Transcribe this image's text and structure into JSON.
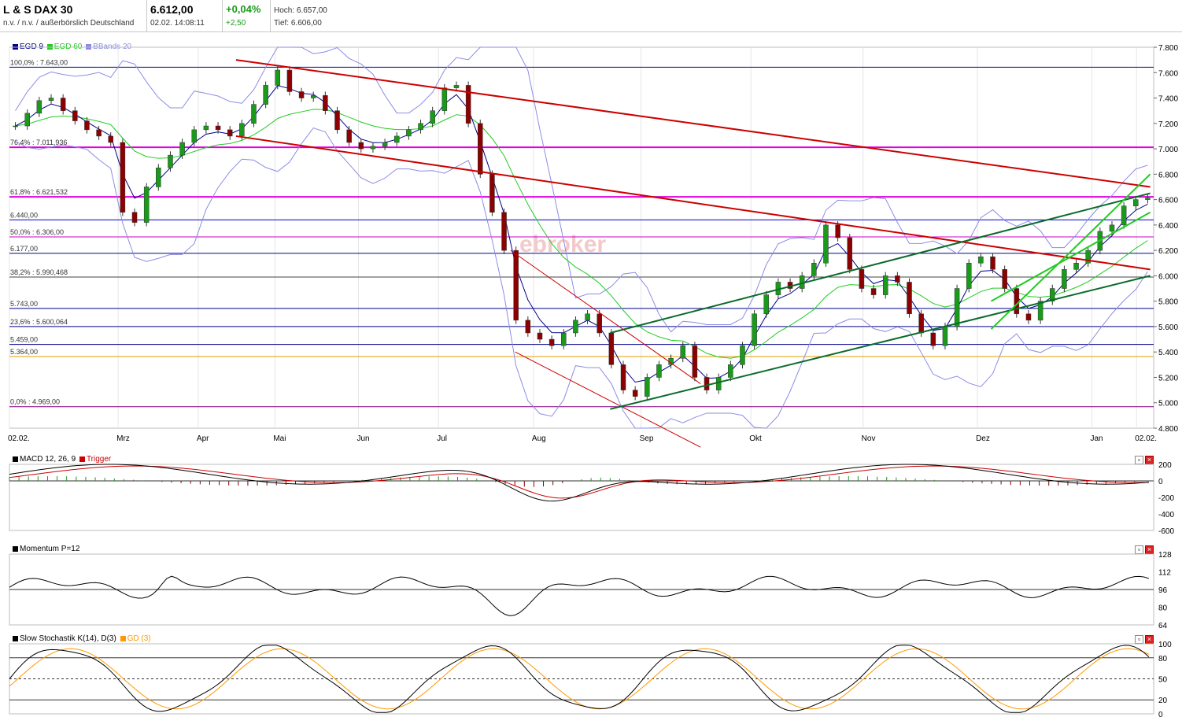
{
  "header": {
    "name": "L & S DAX 30",
    "exchange": "n.v. / n.v. / außerbörslich Deutschland",
    "price": "6.612,00",
    "datetime": "02.02. 14:08:11",
    "change_pct": "+0,04%",
    "change_abs": "+2,50",
    "high": "Hoch: 6.657,00",
    "low": "Tief: 6.606,00"
  },
  "main_panel": {
    "legend": [
      {
        "label": "EGD 9",
        "color": "#00008b"
      },
      {
        "label": "EGD 60",
        "color": "#22cc22"
      },
      {
        "label": "BBands 20",
        "color": "#8c8ce6"
      }
    ],
    "watermark": "ebroker",
    "colors": {
      "up": "#1a9a1a",
      "down": "#8b0000",
      "ema9": "#00008b",
      "ema60": "#22cc22",
      "bb": "#8c8ce6",
      "trend_red": "#cc0000",
      "trend_green": "#0a6b2a",
      "fib": "#000000"
    }
  },
  "chart_data": [
    {
      "type": "candlestick",
      "title": "L & S DAX 30",
      "y_ticks": [
        "7.800",
        "7.600",
        "7.400",
        "7.200",
        "7.000",
        "6.800",
        "6.600",
        "6.400",
        "6.200",
        "6.000",
        "5.800",
        "5.600",
        "5.400",
        "5.200",
        "5.000",
        "4.800"
      ],
      "ylim": [
        4800,
        7800
      ],
      "x_ticks": [
        "02.02.",
        "Mrz",
        "Apr",
        "Mai",
        "Jun",
        "Jul",
        "Aug",
        "Sep",
        "Okt",
        "Nov",
        "Dez",
        "Jan",
        "02.02."
      ],
      "levels": [
        {
          "label": "100,0% : 7.643,00",
          "value": 7643,
          "color": "#00008b"
        },
        {
          "label": "76,4% : 7.011,936",
          "value": 7011.936,
          "color": "#e000e0"
        },
        {
          "label": "61,8% : 6.621,532",
          "value": 6621.532,
          "color": "#e000e0"
        },
        {
          "label": "6.440,00",
          "value": 6440,
          "color": "#0000cc"
        },
        {
          "label": "50,0% : 6.306,00",
          "value": 6306,
          "color": "#cc00cc"
        },
        {
          "label": "6.177,00",
          "value": 6177,
          "color": "#00008b"
        },
        {
          "label": "38,2% : 5.990,468",
          "value": 5990.468,
          "color": "#444444"
        },
        {
          "label": "5.743,00",
          "value": 5743,
          "color": "#00008b"
        },
        {
          "label": "23,6% : 5.600,064",
          "value": 5600.064,
          "color": "#00008b"
        },
        {
          "label": "5.459,00",
          "value": 5459,
          "color": "#00008b"
        },
        {
          "label": "5.364,00",
          "value": 5364,
          "color": "#e0a000"
        },
        {
          "label": "0,0% : 4.969,00",
          "value": 4969,
          "color": "#800080"
        }
      ],
      "close_series": [
        7180,
        7280,
        7380,
        7400,
        7300,
        7220,
        7150,
        7100,
        7050,
        6500,
        6420,
        6700,
        6850,
        6950,
        7050,
        7150,
        7180,
        7150,
        7100,
        7200,
        7350,
        7500,
        7620,
        7450,
        7400,
        7420,
        7300,
        7150,
        7050,
        7000,
        7020,
        7050,
        7100,
        7150,
        7200,
        7300,
        7480,
        7500,
        7200,
        6800,
        6500,
        6200,
        5650,
        5550,
        5500,
        5450,
        5550,
        5650,
        5700,
        5550,
        5300,
        5100,
        5050,
        5200,
        5300,
        5350,
        5450,
        5200,
        5100,
        5200,
        5300,
        5450,
        5700,
        5850,
        5950,
        5900,
        6000,
        6100,
        6400,
        6300,
        6050,
        5900,
        5850,
        6000,
        5950,
        5700,
        5550,
        5450,
        5600,
        5900,
        6100,
        6150,
        6050,
        5900,
        5700,
        5650,
        5800,
        5900,
        6050,
        6100,
        6200,
        6350,
        6400,
        6550,
        6600,
        6612
      ]
    },
    {
      "type": "line",
      "title": "MACD 12, 26, 9",
      "series": [
        {
          "name": "MACD 12, 26, 9"
        },
        {
          "name": "Trigger"
        }
      ],
      "y_ticks": [
        "200",
        "0",
        "-200",
        "-400",
        "-600"
      ],
      "ylim": [
        -600,
        200
      ]
    },
    {
      "type": "line",
      "title": "Momentum P=12",
      "y_ticks": [
        "128",
        "112",
        "96",
        "80",
        "64"
      ],
      "ylim": [
        64,
        128
      ]
    },
    {
      "type": "line",
      "title": "Slow Stochastik K(14), D(3)",
      "series": [
        {
          "name": "Slow Stochastik K(14), D(3)"
        },
        {
          "name": "GD (3)"
        }
      ],
      "y_ticks": [
        "100",
        "80",
        "50",
        "20",
        "0"
      ],
      "ylim": [
        0,
        100
      ]
    }
  ],
  "macd_panel": {
    "legend": [
      {
        "label": "MACD 12, 26, 9",
        "color": "#000000"
      },
      {
        "label": "Trigger",
        "color": "#cc0000"
      }
    ]
  },
  "momentum_panel": {
    "legend": [
      {
        "label": "Momentum P=12",
        "color": "#000000"
      }
    ]
  },
  "stoch_panel": {
    "legend": [
      {
        "label": "Slow Stochastik K(14), D(3)",
        "color": "#000000"
      },
      {
        "label": "GD (3)",
        "color": "#ff9900"
      }
    ]
  }
}
